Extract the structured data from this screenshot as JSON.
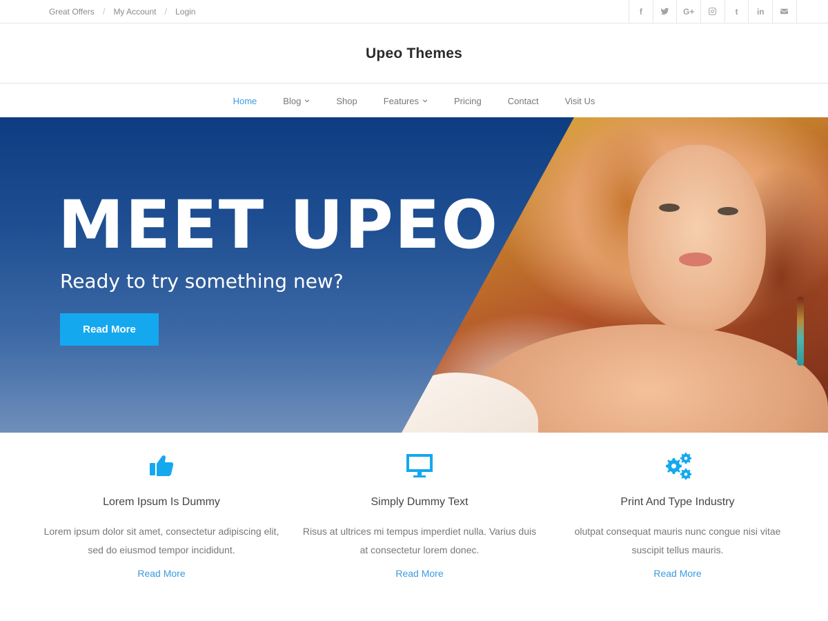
{
  "topbar": {
    "links": [
      "Great Offers",
      "My Account",
      "Login"
    ],
    "social": [
      {
        "icon": "facebook-icon",
        "glyph": "f"
      },
      {
        "icon": "twitter-icon",
        "glyph": ""
      },
      {
        "icon": "google-plus-icon",
        "glyph": "G+"
      },
      {
        "icon": "instagram-icon",
        "glyph": ""
      },
      {
        "icon": "tumblr-icon",
        "glyph": "t"
      },
      {
        "icon": "linkedin-icon",
        "glyph": "in"
      },
      {
        "icon": "envelope-icon",
        "glyph": ""
      }
    ]
  },
  "site": {
    "title": "Upeo Themes"
  },
  "nav": {
    "items": [
      {
        "label": "Home",
        "active": true,
        "dropdown": false
      },
      {
        "label": "Blog",
        "active": false,
        "dropdown": true
      },
      {
        "label": "Shop",
        "active": false,
        "dropdown": false
      },
      {
        "label": "Features",
        "active": false,
        "dropdown": true
      },
      {
        "label": "Pricing",
        "active": false,
        "dropdown": false
      },
      {
        "label": "Contact",
        "active": false,
        "dropdown": false
      },
      {
        "label": "Visit Us",
        "active": false,
        "dropdown": false
      }
    ]
  },
  "hero": {
    "headline": "MEET UPEO",
    "subheadline": "Ready to try something new?",
    "button": "Read More"
  },
  "features": [
    {
      "icon": "thumbs-up-icon",
      "title": "Lorem Ipsum Is Dummy",
      "line1": "Lorem ipsum dolor sit amet, consectetur adipiscing elit,",
      "line2": "sed do eiusmod tempor incididunt.",
      "link": "Read More"
    },
    {
      "icon": "monitor-icon",
      "title": "Simply Dummy Text",
      "line1": "Risus at ultrices mi tempus imperdiet nulla. Varius duis",
      "line2": "at consectetur lorem donec.",
      "link": "Read More"
    },
    {
      "icon": "gears-icon",
      "title": "Print And Type Industry",
      "line1": "olutpat consequat mauris nunc congue nisi vitae",
      "line2": "suscipit tellus mauris.",
      "link": "Read More"
    }
  ],
  "colors": {
    "accent": "#14a8ef",
    "link": "#3a9be0",
    "hero_top": "#0e3c82",
    "hero_bottom": "#6f8fbb"
  }
}
